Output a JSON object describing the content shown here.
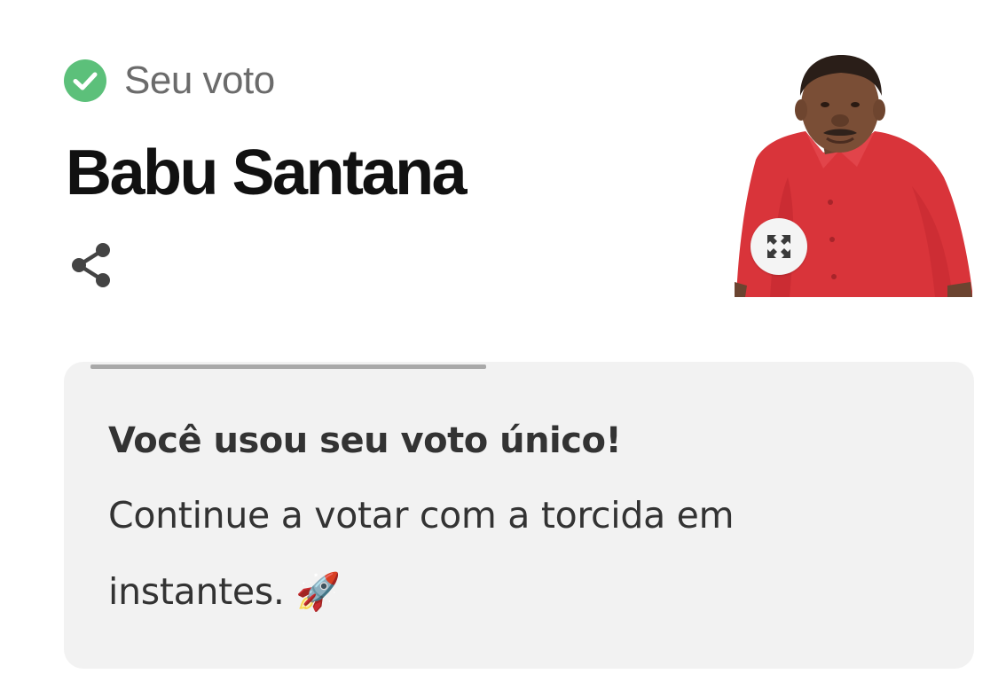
{
  "vote_status": {
    "label": "Seu voto",
    "icon": "check-circle-icon",
    "color": "#5cc07a"
  },
  "candidate": {
    "name": "Babu Santana",
    "photo_alt": "Babu Santana"
  },
  "actions": {
    "share_icon": "share-icon",
    "expand_icon": "expand-icon"
  },
  "notice": {
    "title": "Você usou seu voto único!",
    "message": "Continue a votar com a torcida em instantes. 🚀"
  },
  "colors": {
    "card_background": "#f2f2f2",
    "progress_track": "#a9a9a9",
    "shirt_red": "#d9343a"
  }
}
